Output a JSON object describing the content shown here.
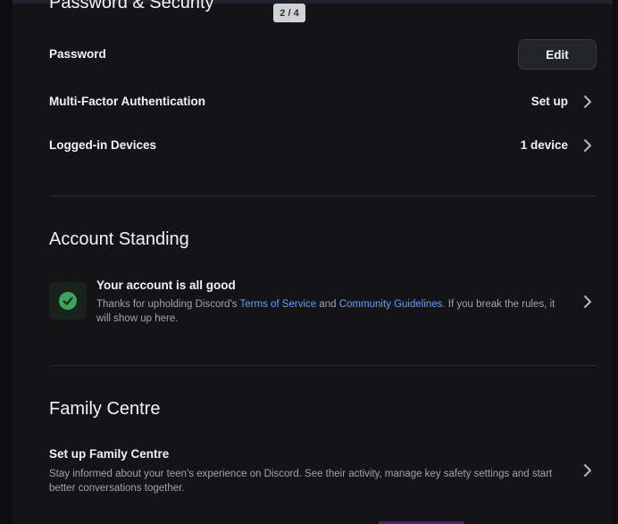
{
  "page_indicator": "2 / 4",
  "password_security": {
    "title": "Password & Security",
    "password_label": "Password",
    "edit_button_label": "Edit",
    "mfa_label": "Multi-Factor Authentication",
    "mfa_value": "Set up",
    "devices_label": "Logged-in Devices",
    "devices_value": "1 device"
  },
  "account_standing": {
    "title": "Account Standing",
    "status_title": "Your account is all good",
    "desc_prefix": "Thanks for upholding Discord's ",
    "tos_link": "Terms of Service",
    "desc_and": " and ",
    "guidelines_link": "Community Guidelines",
    "desc_suffix": ". If you break the rules, it will show up here."
  },
  "family_centre": {
    "title": "Family Centre",
    "setup_title": "Set up Family Centre",
    "setup_desc": "Stay informed about your teen's experience on Discord. See their activity, manage key safety settings and start better conversations together."
  },
  "colors": {
    "background": "#141416",
    "text_primary": "#f2f3f5",
    "text_secondary": "#a0a3a8",
    "link": "#5aa0ff",
    "success": "#3ba55c"
  },
  "icons": {
    "chevron": "chevron-right-icon",
    "check": "check-circle-icon"
  }
}
